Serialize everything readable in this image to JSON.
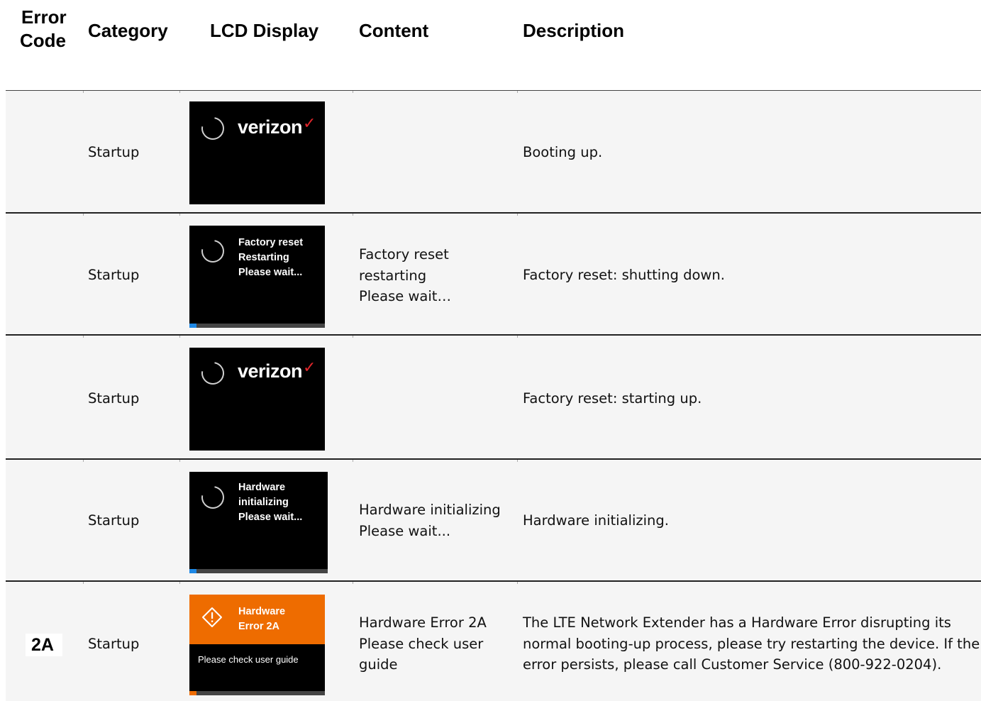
{
  "headers": {
    "error_code_line1": "Error",
    "error_code_line2": "Code",
    "category": "Category",
    "lcd_display": "LCD Display",
    "content": "Content",
    "description": "Description"
  },
  "colors": {
    "row_background": "#f5f5f5",
    "lcd_background": "#000000",
    "error_orange": "#ee6c00",
    "progress_blue": "#1e88e5",
    "verizon_check_red": "#e0262b"
  },
  "rows": [
    {
      "error_code": "",
      "category": "Startup",
      "lcd": {
        "brand": "verizon",
        "brand_mark": "✓",
        "icon": "spinner-icon"
      },
      "content": [],
      "description": "Booting up."
    },
    {
      "error_code": "",
      "category": "Startup",
      "lcd": {
        "lines": [
          "Factory reset",
          "Restarting",
          "Please wait..."
        ],
        "icon": "spinner-icon",
        "progress": 0.05
      },
      "content": [
        "Factory reset",
        "restarting",
        "Please wait…"
      ],
      "description": "Factory reset: shutting down."
    },
    {
      "error_code": "",
      "category": "Startup",
      "lcd": {
        "brand": "verizon",
        "brand_mark": "✓",
        "icon": "spinner-icon"
      },
      "content": [],
      "description": "Factory reset: starting up."
    },
    {
      "error_code": "",
      "category": "Startup",
      "lcd": {
        "lines": [
          "Hardware",
          "initializing",
          "Please wait..."
        ],
        "icon": "spinner-icon",
        "progress": 0.05
      },
      "content": [
        "Hardware initializing",
        "Please wait..."
      ],
      "description": "Hardware initializing."
    },
    {
      "error_code": "2A",
      "category": "Startup",
      "lcd": {
        "lines": [
          "Hardware",
          "Error 2A"
        ],
        "sub": "Please check user guide",
        "icon": "warning-icon",
        "progress": 0.05
      },
      "content": [
        "Hardware Error 2A",
        "Please check user",
        "guide"
      ],
      "description": [
        "The LTE Network Extender has a Hardware Error disrupting its",
        "normal booting-up process, please try restarting the device. If the",
        "error persists, please call Customer Service (800-922-0204)."
      ]
    }
  ]
}
